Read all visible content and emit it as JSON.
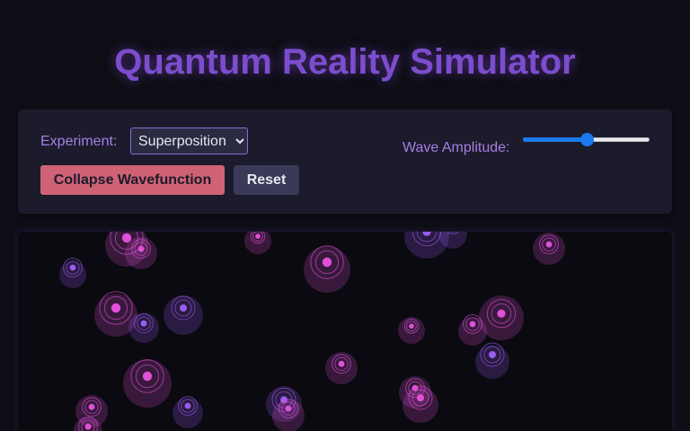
{
  "app": {
    "title": "Quantum Reality Simulator"
  },
  "controls": {
    "experiment_label": "Experiment:",
    "experiment_selected": "Superposition",
    "wave_amplitude_label": "Wave Amplitude:",
    "wave_amplitude_level": 0.5,
    "collapse_label": "Collapse Wavefunction",
    "reset_label": "Reset"
  },
  "colors": {
    "title": "#7c4dcc",
    "accent_label": "#a77ee6",
    "collapse_button": "#d06275",
    "reset_button": "#3a3a58",
    "particle_pink": "#e050d8",
    "particle_violet": "#9a5cf0"
  },
  "simulation": {
    "particle_count": 24
  }
}
